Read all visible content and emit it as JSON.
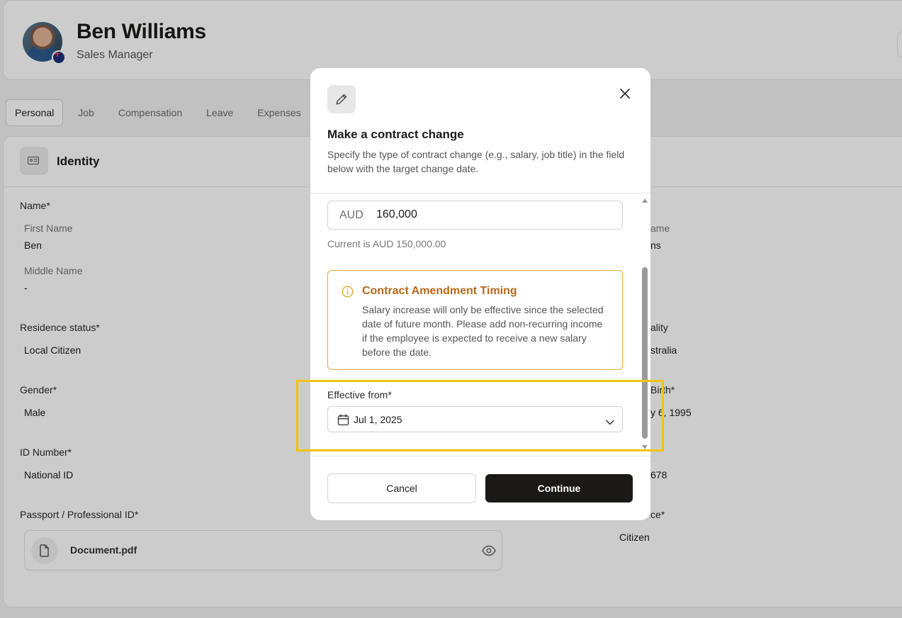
{
  "profile": {
    "name": "Ben Williams",
    "role": "Sales Manager"
  },
  "tabs": [
    "Personal",
    "Job",
    "Compensation",
    "Leave",
    "Expenses"
  ],
  "identity": {
    "section_title": "Identity",
    "name_label": "Name*",
    "first_name_label": "First Name",
    "first_name_value": "Ben",
    "last_name_label_partial": "ame",
    "last_name_value_partial": "ns",
    "middle_name_label": "Middle Name",
    "middle_name_value": "-",
    "residence_label": "Residence status*",
    "residence_value": "Local Citizen",
    "nationality_label_partial": "ality",
    "nationality_value_partial": "stralia",
    "gender_label": "Gender*",
    "gender_value": "Male",
    "birth_label_partial": "Birth*",
    "birth_value_partial": "y 6, 1995",
    "id_number_label": "ID Number*",
    "id_number_value": "National ID",
    "id_value_partial": "678",
    "passport_label": "Passport / Professional ID*",
    "document_name": "Document.pdf",
    "residence_type_label_partial": "ce*",
    "residence_type_value": "Citizen"
  },
  "modal": {
    "title": "Make a contract change",
    "description": "Specify the type of contract change (e.g., salary, job title) in the field below with the target change date.",
    "currency": "AUD",
    "amount": "160,000",
    "current_note": "Current is AUD 150,000.00",
    "alert": {
      "title": "Contract Amendment Timing",
      "body": "Salary increase will only be effective since the selected date of future month. Please add non-recurring income if the employee is expected to receive a new salary before the date."
    },
    "effective_label": "Effective from*",
    "effective_date": "Jul 1, 2025",
    "cancel_label": "Cancel",
    "continue_label": "Continue"
  },
  "icons": {
    "edit": "pencil-icon",
    "close": "close-icon",
    "info": "info-icon",
    "calendar": "calendar-icon",
    "dropdown": "chevron-down-icon",
    "document": "file-icon",
    "preview": "eye-icon",
    "identity": "id-card-icon"
  },
  "colors": {
    "primary_button": "#1c1816",
    "alert_border": "#e3ad3b",
    "alert_title": "#b8681c",
    "highlight": "#f1c40f"
  }
}
